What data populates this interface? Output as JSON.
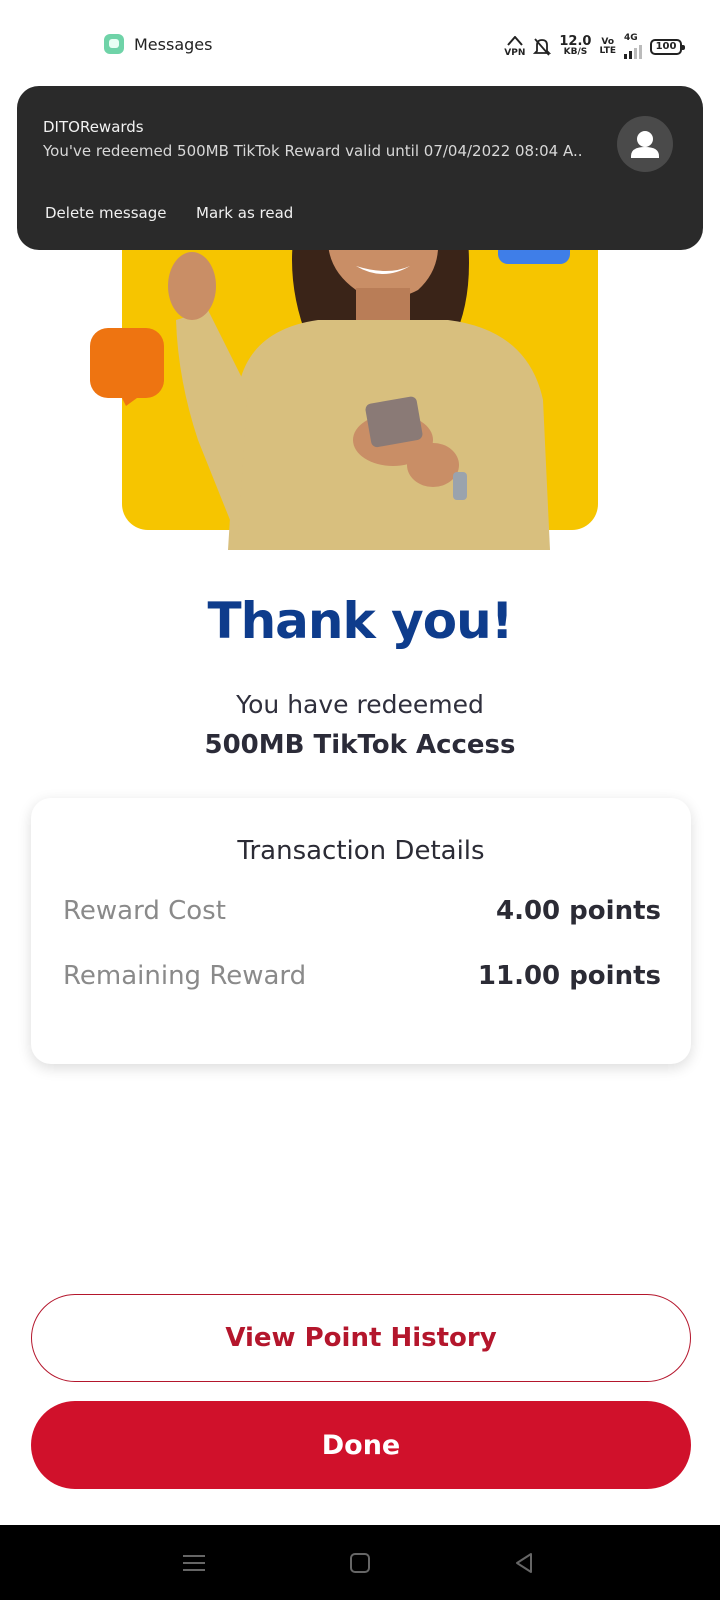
{
  "status_bar": {
    "app_name": "Messages",
    "vpn_label": "VPN",
    "speed_value": "12.0",
    "speed_unit": "KB/S",
    "volte_top": "Vo",
    "volte_bottom": "LTE",
    "network": "4G",
    "battery": "100"
  },
  "notification": {
    "sender": "DITORewards",
    "message": "You've redeemed 500MB TikTok Reward valid until 07/04/2022 08:04 A..",
    "actions": [
      "Delete message",
      "Mark as read"
    ]
  },
  "main": {
    "title": "Thank you!",
    "subtitle": "You have redeemed",
    "reward_name": "500MB TikTok Access"
  },
  "transaction": {
    "title": "Transaction Details",
    "rows": [
      {
        "label": "Reward Cost",
        "value": "4.00 points"
      },
      {
        "label": "Remaining Reward",
        "value": "11.00 points"
      }
    ]
  },
  "buttons": {
    "history": "View Point History",
    "done": "Done"
  },
  "colors": {
    "title_blue": "#0e3c8c",
    "primary_red": "#d0112b",
    "hero_yellow": "#f6c500",
    "bubble_orange": "#ee7411"
  }
}
